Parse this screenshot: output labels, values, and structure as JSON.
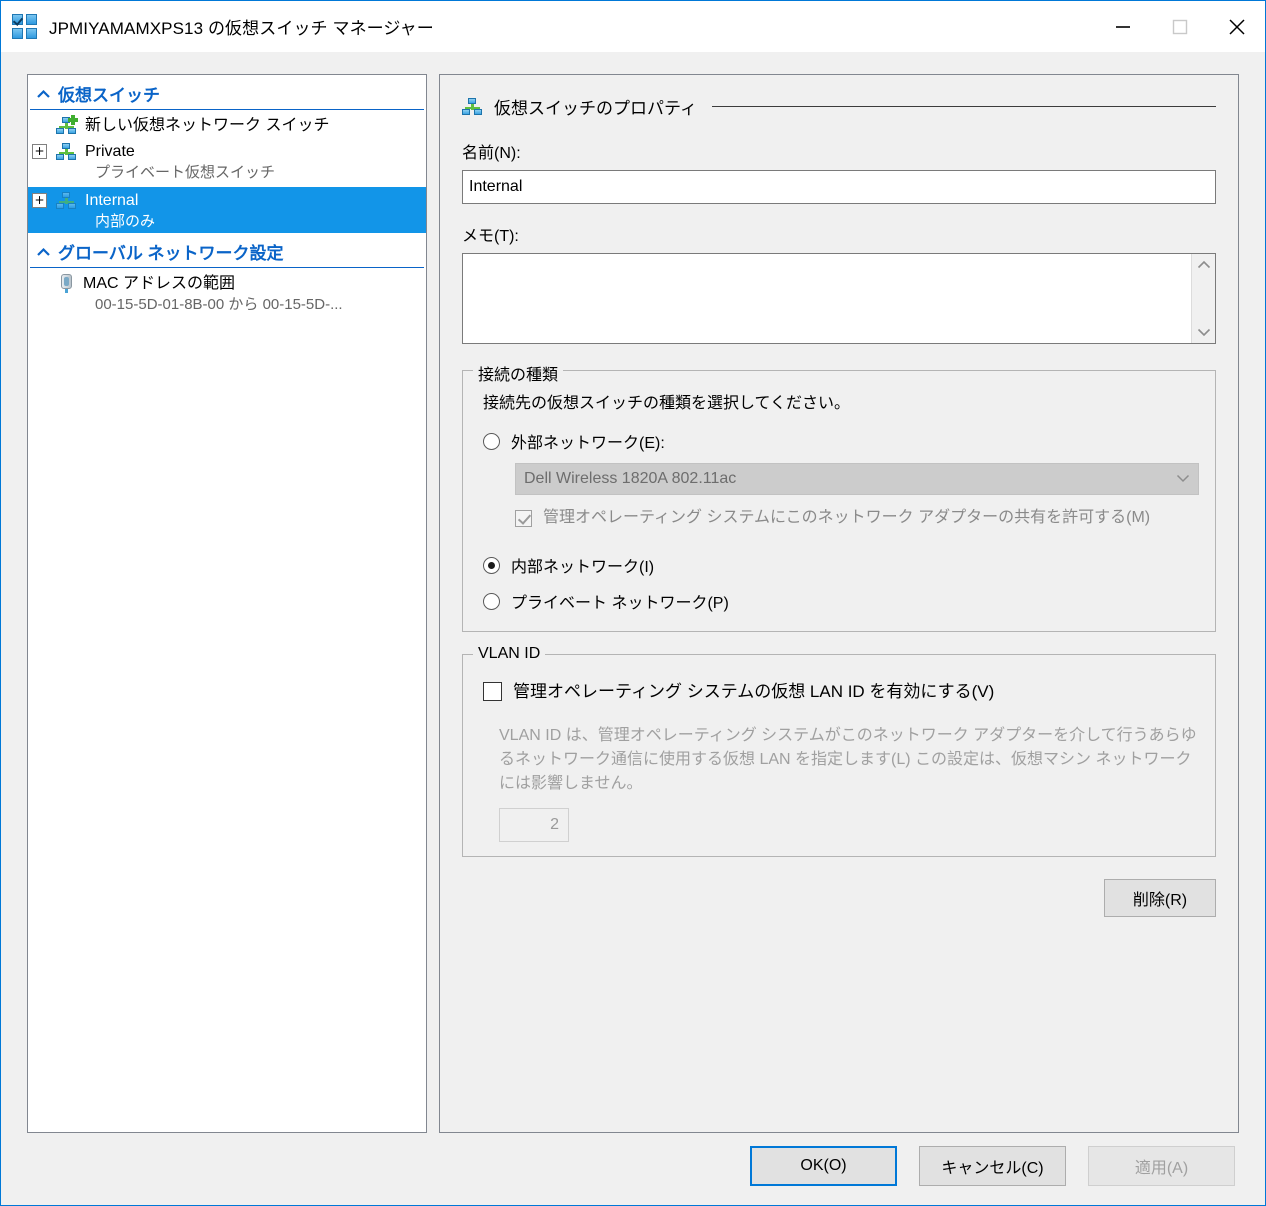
{
  "window": {
    "title": "JPMIYAMAMXPS13 の仮想スイッチ マネージャー",
    "icon": "virtual-switch-manager-icon",
    "controls": {
      "minimize": "minimize-icon",
      "maximize": "maximize-icon",
      "close": "close-icon"
    },
    "accent_color": "#0078d7"
  },
  "tree": {
    "sections": [
      {
        "title": "仮想スイッチ",
        "chevron": "chevron-up-icon",
        "items": [
          {
            "label": "新しい仮想ネットワーク スイッチ",
            "sub": "",
            "icon": "new-virtual-switch-icon",
            "expander": "",
            "selected": false
          },
          {
            "label": "Private",
            "sub": "プライベート仮想スイッチ",
            "icon": "virtual-switch-icon",
            "expander": "+",
            "selected": false
          },
          {
            "label": "Internal",
            "sub": "内部のみ",
            "icon": "virtual-switch-icon",
            "expander": "+",
            "selected": true
          }
        ]
      },
      {
        "title": "グローバル ネットワーク設定",
        "chevron": "chevron-up-icon",
        "items": [
          {
            "label": "MAC アドレスの範囲",
            "sub": "00-15-5D-01-8B-00 から 00-15-5D-...",
            "icon": "mac-address-icon",
            "expander": "",
            "selected": false
          }
        ]
      }
    ],
    "selection_color": "#1295e8",
    "header_color": "#0a64c8"
  },
  "pane": {
    "header": "仮想スイッチのプロパティ",
    "header_icon": "virtual-switch-icon",
    "name_label": "名前(N):",
    "name_value": "Internal",
    "memo_label": "メモ(T):",
    "memo_value": "",
    "memo_placeholder": "",
    "connection": {
      "legend": "接続の種類",
      "description": "接続先の仮想スイッチの種類を選択してください。",
      "options": [
        {
          "label": "外部ネットワーク(E):",
          "selected": false
        },
        {
          "label": "内部ネットワーク(I)",
          "selected": true
        },
        {
          "label": "プライベート ネットワーク(P)",
          "selected": false
        }
      ],
      "adapter_value": "Dell Wireless 1820A 802.11ac",
      "adapter_caret": "chevron-down-icon",
      "share_checkbox_label": "管理オペレーティング システムにこのネットワーク アダプターの共有を許可する(M)",
      "share_checkbox_checked": true,
      "share_checkbox_enabled": false
    },
    "vlan": {
      "legend": "VLAN ID",
      "checkbox_label": "管理オペレーティング システムの仮想 LAN ID を有効にする(V)",
      "checkbox_checked": false,
      "description": "VLAN ID は、管理オペレーティング システムがこのネットワーク アダプターを介して行うあらゆるネットワーク通信に使用する仮想 LAN を指定します(L) この設定は、仮想マシン ネットワークには影響しません。",
      "id_value": "2",
      "id_enabled": false
    },
    "delete_label": "削除(R)"
  },
  "footer": {
    "ok_label": "OK(O)",
    "cancel_label": "キャンセル(C)",
    "apply_label": "適用(A)",
    "apply_enabled": false
  }
}
